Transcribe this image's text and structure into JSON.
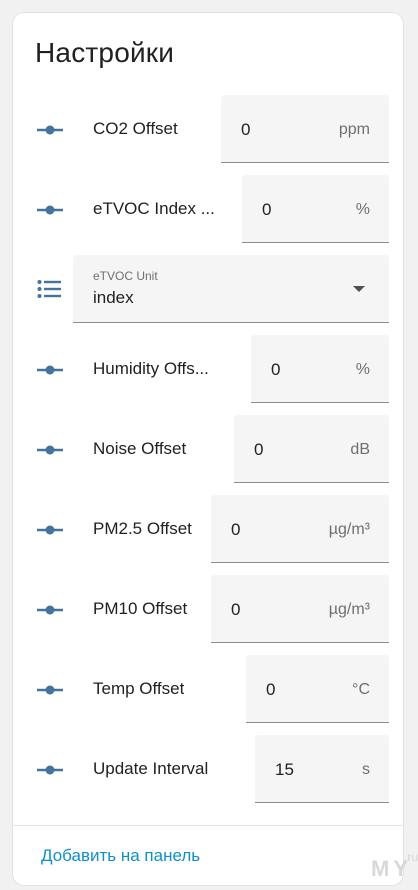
{
  "card": {
    "title": "Настройки",
    "footer_link": "Добавить на панель"
  },
  "watermark": {
    "text": "MY",
    "suffix": ".ru"
  },
  "entities": [
    {
      "label": "CO2 Offset",
      "value": "0",
      "unit": "ppm",
      "icon": "slider-icon"
    },
    {
      "label": "eTVOC Index ...",
      "value": "0",
      "unit": "%",
      "icon": "slider-icon"
    },
    {
      "label": "Humidity Offs...",
      "value": "0",
      "unit": "%",
      "icon": "slider-icon"
    },
    {
      "label": "Noise Offset",
      "value": "0",
      "unit": "dB",
      "icon": "slider-icon"
    },
    {
      "label": "PM2.5 Offset",
      "value": "0",
      "unit": "µg/m³",
      "icon": "slider-icon"
    },
    {
      "label": "PM10 Offset",
      "value": "0",
      "unit": "µg/m³",
      "icon": "slider-icon"
    },
    {
      "label": "Temp Offset",
      "value": "0",
      "unit": "°C",
      "icon": "slider-icon"
    },
    {
      "label": "Update Interval",
      "value": "15",
      "unit": "s",
      "icon": "slider-icon"
    }
  ],
  "select": {
    "label": "eTVOC Unit",
    "value": "index",
    "icon": "list-icon"
  },
  "colors": {
    "icon": "#44739e",
    "link": "#0e8fc7",
    "field_bg": "#f5f5f5"
  }
}
